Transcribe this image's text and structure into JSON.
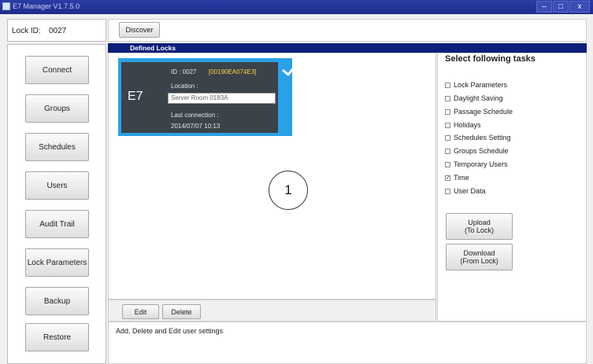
{
  "window": {
    "title": "E7 Manager V1.7.5.0",
    "buttons": [
      "–",
      "□",
      "x"
    ]
  },
  "lock_id": {
    "label": "Lock ID:",
    "value": "0027"
  },
  "toolbar": {
    "discover_label": "Discover"
  },
  "nav": {
    "items": [
      {
        "label": "Connect"
      },
      {
        "label": "Groups"
      },
      {
        "label": "Schedules"
      },
      {
        "label": "Users"
      },
      {
        "label": "Audit Trail"
      },
      {
        "label": "Lock Parameters"
      },
      {
        "label": "Backup"
      },
      {
        "label": "Restore"
      }
    ]
  },
  "defined_locks": {
    "title": "Defined Locks",
    "card": {
      "model": "E7",
      "id_label": "ID : 0027",
      "mac": "[00190EA074E3]",
      "location_label": "Location :",
      "location_value": "Server Room 0183A",
      "last_connection_label": "Last connection :",
      "last_connection_value": "2014/07/07 10:13",
      "selected": true,
      "accent_color": "#2aa0e6"
    },
    "callout_number": "1"
  },
  "edit_bar": {
    "edit_label": "Edit",
    "delete_label": "Delete"
  },
  "tasks": {
    "title": "Select following tasks",
    "items": [
      {
        "label": "Lock Parameters",
        "checked": false
      },
      {
        "label": "Daylight Saving",
        "checked": false
      },
      {
        "label": "Passage Schedule",
        "checked": false
      },
      {
        "label": "Holidays",
        "checked": false
      },
      {
        "label": "Schedules Setting",
        "checked": false
      },
      {
        "label": "Groups Schedule",
        "checked": false
      },
      {
        "label": "Temporary Users",
        "checked": false
      },
      {
        "label": "Time",
        "checked": true
      },
      {
        "label": "User Data",
        "checked": false
      }
    ],
    "upload_label": "Upload (To Lock)",
    "upload_lines": [
      "Upload",
      "(To Lock)"
    ],
    "download_lines": [
      "Download",
      "(From Lock)"
    ]
  },
  "status": {
    "text": "Add, Delete and Edit user settings"
  }
}
